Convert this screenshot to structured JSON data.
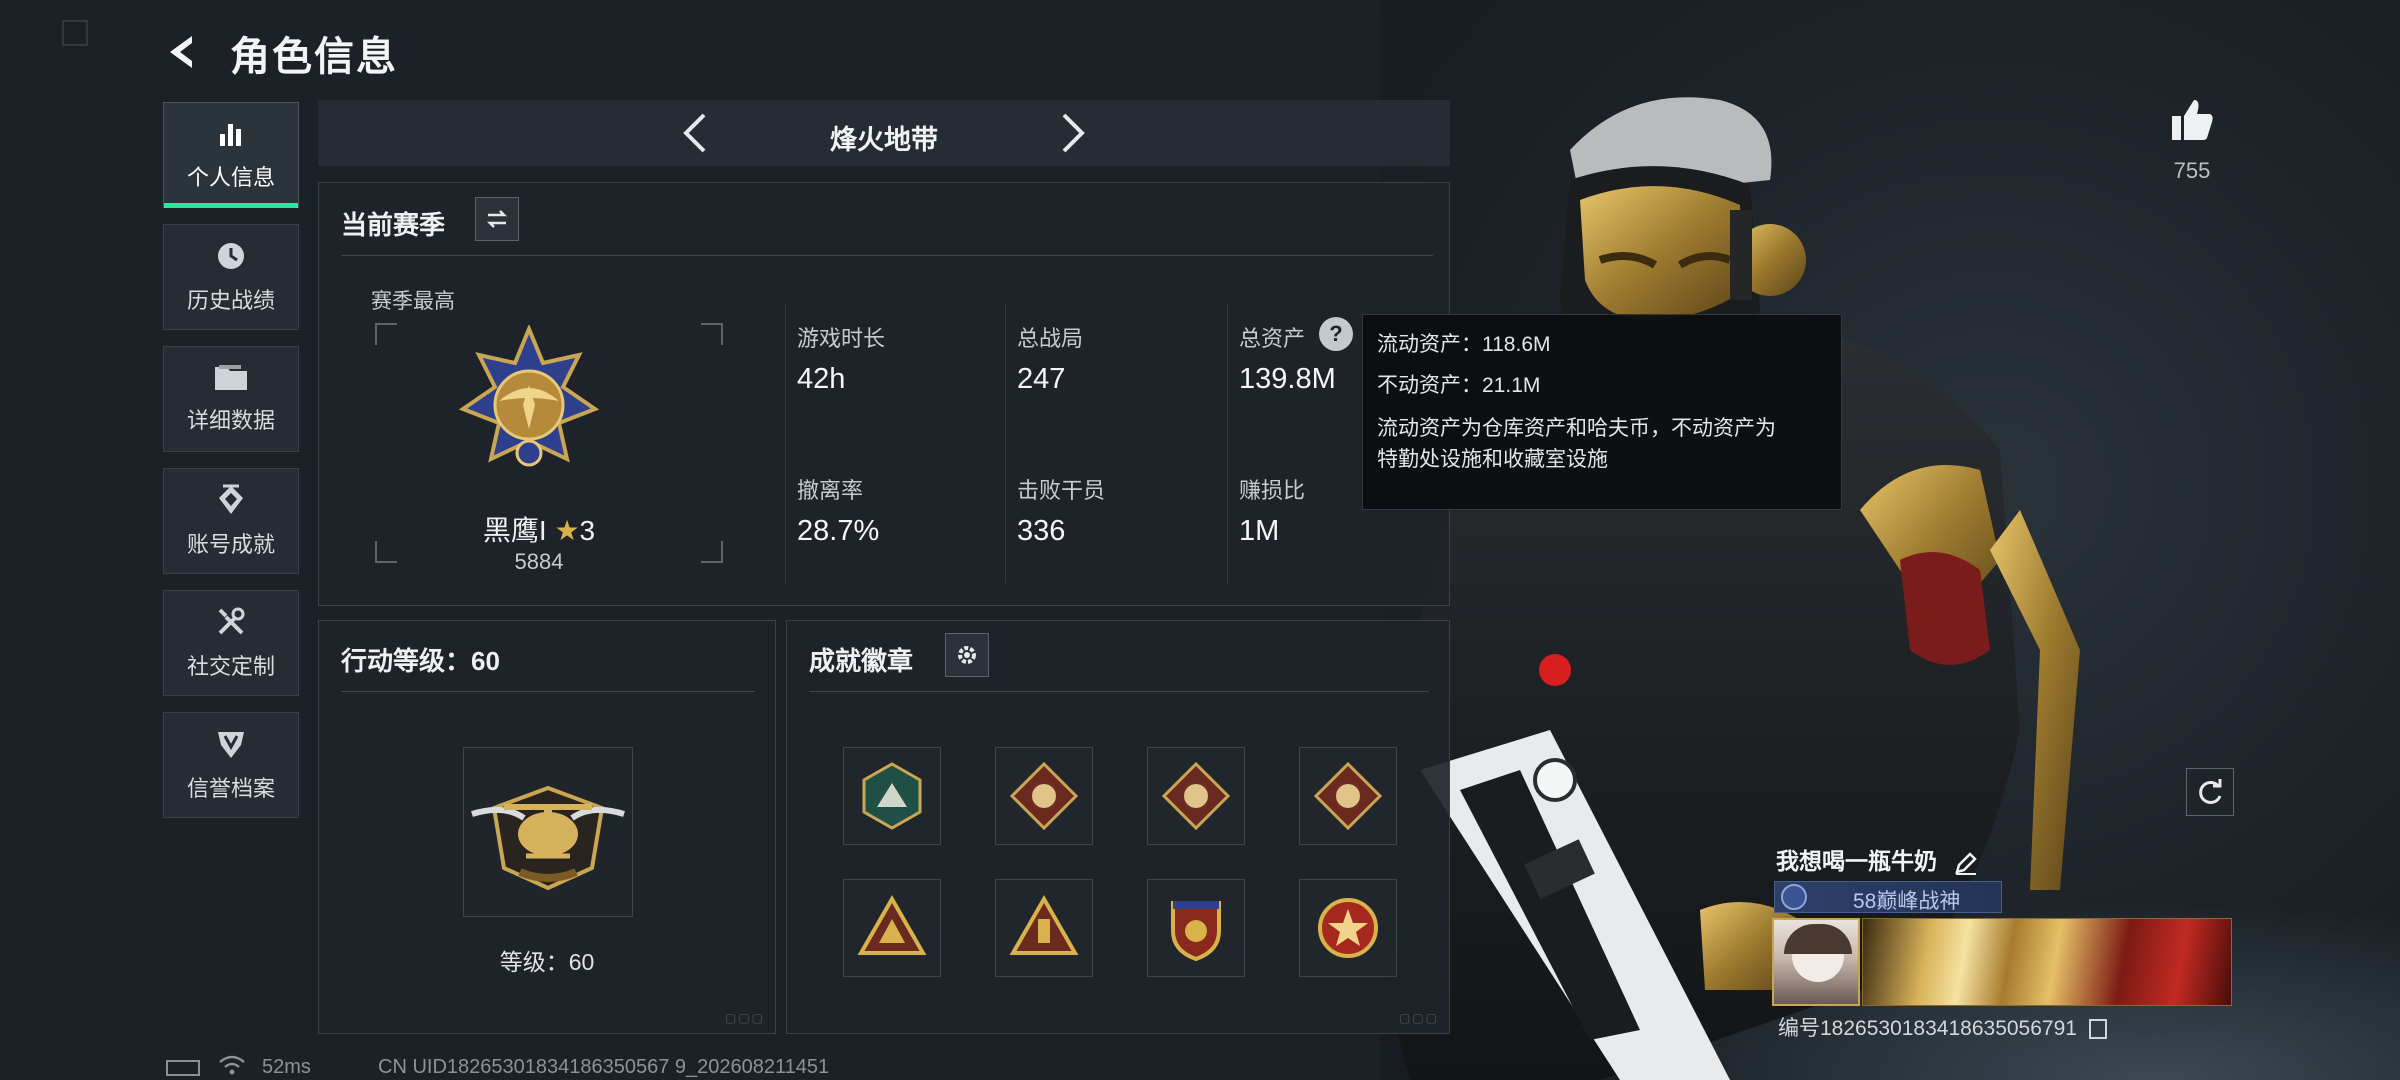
{
  "header": {
    "title": "角色信息",
    "back_icon": "back-arrow-icon"
  },
  "sidebar": {
    "items": [
      {
        "label": "个人信息",
        "icon": "bar-chart-icon",
        "active": true
      },
      {
        "label": "历史战绩",
        "icon": "clock-icon",
        "active": false
      },
      {
        "label": "详细数据",
        "icon": "folder-icon",
        "active": false
      },
      {
        "label": "账号成就",
        "icon": "achievement-icon",
        "active": false
      },
      {
        "label": "社交定制",
        "icon": "tools-icon",
        "active": false
      },
      {
        "label": "信誉档案",
        "icon": "shield-icon",
        "active": false
      }
    ]
  },
  "mode_nav": {
    "title": "烽火地带"
  },
  "season": {
    "header": "当前赛季",
    "best_label": "赛季最高",
    "rank_name": "黑鹰I",
    "rank_stars": "3",
    "rank_score": "5884",
    "stats": [
      {
        "label": "游戏时长",
        "value": "42h"
      },
      {
        "label": "总战局",
        "value": "247"
      },
      {
        "label": "总资产",
        "value": "139.8M"
      },
      {
        "label": "撤离率",
        "value": "28.7%"
      },
      {
        "label": "击败干员",
        "value": "336"
      },
      {
        "label": "赚损比",
        "value": "1M"
      }
    ]
  },
  "tooltip": {
    "line1": "流动资产：118.6M",
    "line2": "不动资产：21.1M",
    "line3": "流动资产为仓库资产和哈夫币，不动资产为",
    "line4": "特勤处设施和收藏室设施"
  },
  "action_level": {
    "header": "行动等级：60",
    "level_text": "等级：60"
  },
  "achievements": {
    "header": "成就徽章",
    "badges": [
      "hex-green-badge",
      "diamond-red-badge",
      "diamond-red-badge",
      "diamond-red-badge",
      "triangle-gold-badge",
      "triangle-gold-badge",
      "shield-gold-badge",
      "star-red-badge"
    ]
  },
  "likes": {
    "count": "755"
  },
  "player": {
    "name": "我想喝一瓶牛奶",
    "title": "58巅峰战神",
    "id_text": "编号1826530183418635056791"
  },
  "status_bar": {
    "ping": "52ms",
    "uid_text": "CN UID18265301834186350567 9_202608211451"
  },
  "colors": {
    "accent": "#2ee6a0",
    "gold": "#c9a653",
    "panel": "#1e242a"
  }
}
